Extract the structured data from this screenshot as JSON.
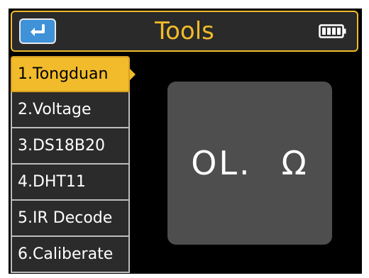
{
  "header": {
    "title": "Tools",
    "back_icon": "back-arrow-icon",
    "battery_icon": "battery-full-icon"
  },
  "menu": {
    "items": [
      {
        "label": "1.Tongduan",
        "selected": true
      },
      {
        "label": "2.Voltage",
        "selected": false
      },
      {
        "label": "3.DS18B20",
        "selected": false
      },
      {
        "label": "4.DHT11",
        "selected": false
      },
      {
        "label": "5.IR Decode",
        "selected": false
      },
      {
        "label": "6.Caliberate",
        "selected": false
      }
    ]
  },
  "readout": {
    "value": "OL.",
    "unit": "Ω"
  },
  "colors": {
    "accent": "#f1bb2b",
    "back_button": "#3f92d8",
    "panel": "#4e4e4e",
    "background": "#000000"
  }
}
